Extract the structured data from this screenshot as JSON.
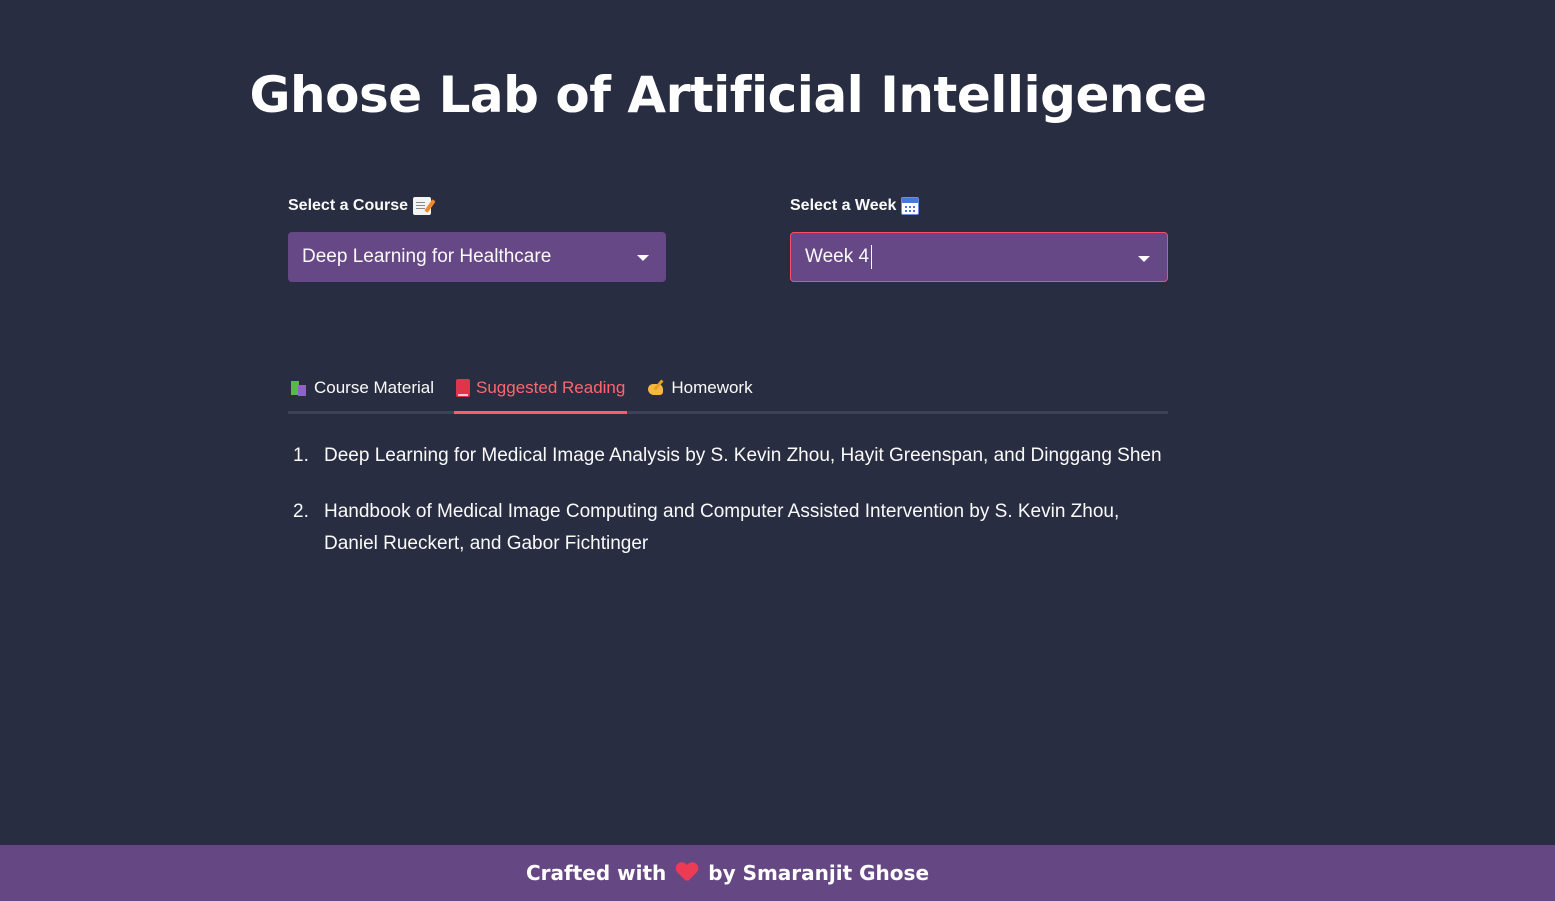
{
  "app": {
    "title": "Ghose Lab of Artificial Intelligence"
  },
  "course_select": {
    "label": "Select a Course",
    "label_icon": "memo-icon",
    "value": "Deep Learning for Healthcare"
  },
  "week_select": {
    "label": "Select a Week",
    "label_icon": "calendar-icon",
    "value": "Week 4"
  },
  "tabs": [
    {
      "label": "Course Material",
      "icon": "books-icon",
      "active": false
    },
    {
      "label": "Suggested Reading",
      "icon": "book-icon",
      "active": true
    },
    {
      "label": "Homework",
      "icon": "writing-hand-icon",
      "active": false
    }
  ],
  "readings": [
    {
      "number": "1.",
      "text": "Deep Learning for Medical Image Analysis by S. Kevin Zhou, Hayit Greenspan, and Dinggang Shen"
    },
    {
      "number": "2.",
      "text": "Handbook of Medical Image Computing and Computer Assisted Intervention by S. Kevin Zhou, Daniel Rueckert, and Gabor Fichtinger"
    }
  ],
  "footer": {
    "prefix": "Crafted with",
    "icon": "heart-icon",
    "suffix": "by Smaranjit Ghose"
  },
  "colors": {
    "background": "#282d41",
    "select_bg": "#674886",
    "accent": "#ff4b6b",
    "footer_bg": "#654883"
  }
}
